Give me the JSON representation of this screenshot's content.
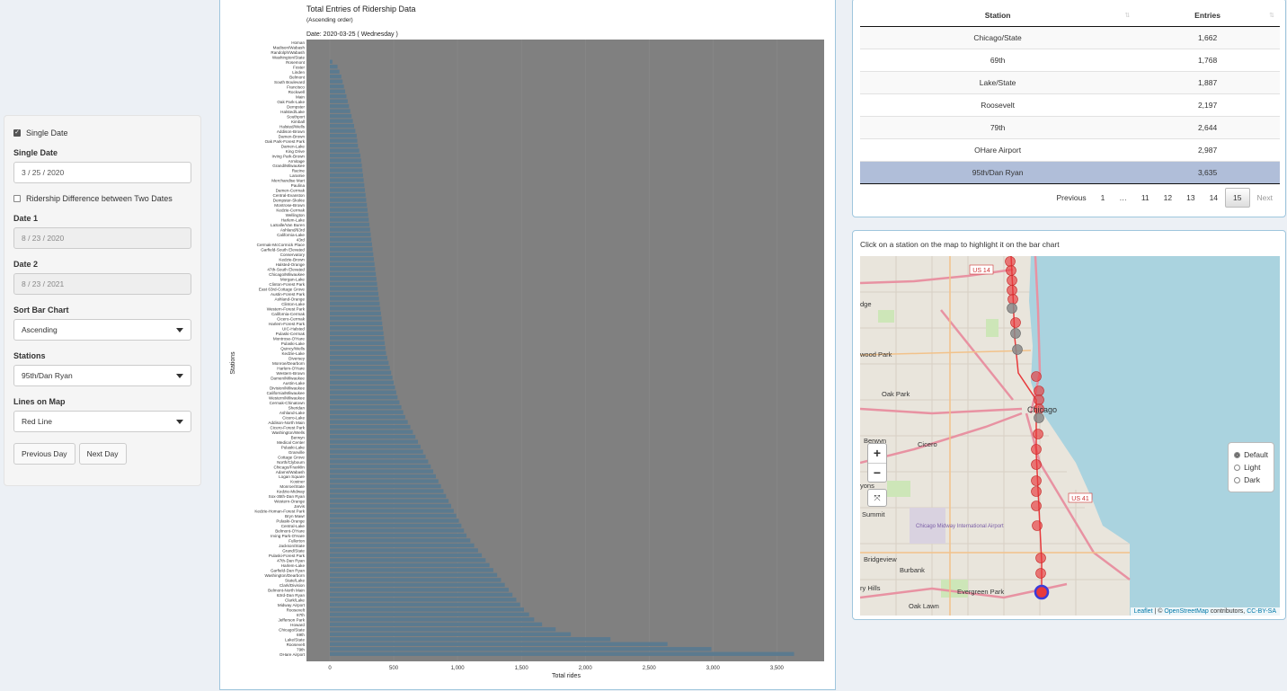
{
  "sidebar": {
    "single_date_checkbox": "Single Date",
    "single_date_label": "Single Date",
    "single_date_value": "3 / 25 / 2020",
    "difference_checkbox": "Ridership Difference between Two Dates",
    "date1_label": "Date 1",
    "date1_value": "8 / 23 / 2020",
    "date2_label": "Date 2",
    "date2_value": "8 / 23 / 2021",
    "sort_label": "Sort Bar Chart",
    "sort_value": "Ascending",
    "stations_label": "Stations",
    "stations_value": "95th/Dan Ryan",
    "lines_label": "Lines on Map",
    "lines_value": "Red Line",
    "prev_day": "Previous Day",
    "next_day": "Next Day"
  },
  "chart": {
    "title": "Total Entries of Ridership Data",
    "subtitle": "(Ascending order)",
    "date_line": "Date:  2020-03-25 ( Wednesday )"
  },
  "chart_data": {
    "type": "bar",
    "orientation": "horizontal",
    "title": "Total Entries of Ridership Data",
    "subtitle": "(Ascending order)",
    "xlabel": "Total rides",
    "ylabel": "Stations",
    "xlim": [
      0,
      3800
    ],
    "xticks": [
      0,
      500,
      1000,
      1500,
      2000,
      2500,
      3000,
      3500
    ],
    "xtick_labels": [
      "0",
      "500",
      "1,000",
      "1,500",
      "2,000",
      "2,500",
      "3,000",
      "3,500"
    ],
    "bar_color": "#5b7a8f",
    "highlight_color": "#f0584c",
    "background": "#808080",
    "highlighted_station": "95th/Dan Ryan",
    "categories": [
      "Homan",
      "Madison/Wabash",
      "Randolph/Wabash",
      "Washington/State",
      "Rosemont",
      "Foster",
      "Linden",
      "Belmont",
      "South Boulevard",
      "Francisco",
      "Rockwell",
      "Main",
      "Oak Park-Lake",
      "Dempster",
      "Halsted/Lake",
      "Southport",
      "Kimball",
      "Halsted/Wells",
      "Addison-Brown",
      "Damen-Brown",
      "Oak Park-Forest Park",
      "Damen-Lake",
      "King Drive",
      "Irving Park-Brown",
      "Armitage",
      "Grand/Milwaukee",
      "Racine",
      "Laramie",
      "Merchandise Mart",
      "Paulina",
      "Damen-Cermak",
      "Central-Evanston",
      "Dempster-Skokie",
      "Montrose-Brown",
      "Kedzie-Cermak",
      "Wellington",
      "Harlem-Lake",
      "LaSalle/Van Buren",
      "Ashland/63rd",
      "California-Lake",
      "43rd",
      "Cermak-McCormick Place",
      "Garfield-South Elevated",
      "Conservatory",
      "Kedzie-Brown",
      "Halsted-Orange",
      "47th-South Elevated",
      "Chicago/Milwaukee",
      "Morgan-Lake",
      "Clinton-Forest Park",
      "East 63rd-Cottage Grove",
      "Austin-Forest Park",
      "Ashland-Orange",
      "Clinton-Lake",
      "Western-Forest Park",
      "California-Cermak",
      "Cicero-Cermak",
      "Harlem-Forest Park",
      "UIC-Halsted",
      "Pulaski-Cermak",
      "Montrose-O'Hare",
      "Pulaski-Lake",
      "Quincy/Wells",
      "Kedzie-Lake",
      "Diversey",
      "Monroe/Dearborn",
      "Harlem-O'Hare",
      "Western-Brown",
      "Damen/Milwaukee",
      "Austin-Lake",
      "Division/Milwaukee",
      "California/Milwaukee",
      "Western/Milwaukee",
      "Cermak-Chinatown",
      "Sheridan",
      "Ashland-Lake",
      "Cicero-Lake",
      "Addison-North Main",
      "Cicero-Forest Park",
      "Washington/Wells",
      "Berwyn",
      "Medical Center",
      "Pulaski-Lake",
      "Granville",
      "Cottage Grove",
      "North/Clybourn",
      "Chicago/Franklin",
      "Adams/Wabash",
      "Logan Square",
      "Kostner",
      "Monroe/State",
      "Kedzie-Midway",
      "Sox-35th-Dan Ryan",
      "Western-Orange",
      "Jarvis",
      "Kedzie-Homan-Forest Park",
      "Bryn Mawr",
      "Pulaski-Orange",
      "Central-Lake",
      "Belmont-O'Hare",
      "Irving Park-O'Hare",
      "Fullerton",
      "Jackson/State",
      "Grand/State",
      "Pulaski-Forest Park",
      "47th-Dan Ryan",
      "Harlem-Lake",
      "Garfield-Dan Ryan",
      "Washington/Dearborn",
      "State/Lake",
      "Clark/Division",
      "Belmont-North Main",
      "63rd-Dan Ryan",
      "Clark/Lake",
      "Midway Airport",
      "Roosevelt",
      "87th",
      "Jefferson Park",
      "Howard",
      "Chicago/State",
      "69th",
      "Lake/State",
      "Roosevelt",
      "79th",
      "OHare Airport",
      "95th/Dan Ryan"
    ],
    "values": [
      0,
      0,
      0,
      0,
      20,
      60,
      75,
      90,
      100,
      110,
      120,
      130,
      140,
      150,
      160,
      170,
      180,
      190,
      200,
      210,
      215,
      220,
      230,
      240,
      245,
      250,
      255,
      260,
      265,
      270,
      275,
      280,
      285,
      290,
      295,
      300,
      305,
      310,
      315,
      320,
      325,
      330,
      335,
      340,
      345,
      350,
      355,
      360,
      365,
      370,
      375,
      380,
      385,
      390,
      395,
      400,
      405,
      410,
      415,
      420,
      425,
      430,
      435,
      440,
      450,
      460,
      470,
      480,
      490,
      500,
      510,
      520,
      530,
      545,
      560,
      575,
      590,
      610,
      630,
      650,
      670,
      690,
      710,
      730,
      750,
      770,
      790,
      810,
      830,
      850,
      870,
      890,
      910,
      930,
      950,
      970,
      990,
      1010,
      1030,
      1050,
      1070,
      1100,
      1130,
      1160,
      1190,
      1220,
      1250,
      1280,
      1310,
      1340,
      1370,
      1400,
      1430,
      1460,
      1490,
      1520,
      1560,
      1600,
      1662,
      1768,
      1887,
      2197,
      2644,
      2987,
      3635
    ]
  },
  "table": {
    "headers": [
      "Station",
      "Entries"
    ],
    "rows": [
      {
        "station": "Chicago/State",
        "entries": "1,662"
      },
      {
        "station": "69th",
        "entries": "1,768"
      },
      {
        "station": "Lake/State",
        "entries": "1,887"
      },
      {
        "station": "Roosevelt",
        "entries": "2,197"
      },
      {
        "station": "79th",
        "entries": "2,644"
      },
      {
        "station": "OHare Airport",
        "entries": "2,987"
      },
      {
        "station": "95th/Dan Ryan",
        "entries": "3,635"
      }
    ],
    "pager": {
      "previous": "Previous",
      "next": "Next",
      "pages": [
        "1",
        "…",
        "11",
        "12",
        "13",
        "14",
        "15"
      ],
      "current": "15"
    }
  },
  "map": {
    "caption": "Click on a station on the map to highlight it on the bar chart",
    "zoom_in": "+",
    "zoom_out": "−",
    "fullscreen": "⤧",
    "layers": [
      "Default",
      "Light",
      "Dark"
    ],
    "selected_layer": "Default",
    "labels": [
      "Chicago",
      "Oak Park",
      "Berwyn",
      "Cicero",
      "Summit",
      "Bridgeview",
      "Burbank",
      "Evergreen Park",
      "Oak Lawn",
      "Chicago Midway International Airport",
      "US 14",
      "US 41",
      "wood Park",
      "dge",
      "yons",
      "ry Hills"
    ],
    "attribution_leaflet": "Leaflet",
    "attribution_osm": "OpenStreetMap",
    "attribution_text": " contributors, ",
    "attribution_license": "CC-BY-SA",
    "colors": {
      "water": "#aad3df",
      "land": "#e9e5dc",
      "highway": "#e892a2",
      "station": "#e8393c",
      "station_grey": "#8a8a8a",
      "selected": "#3b3bd9"
    }
  }
}
